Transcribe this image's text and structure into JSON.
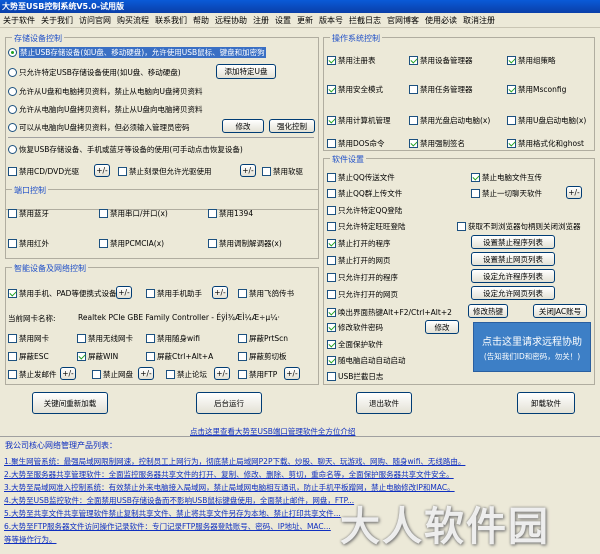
{
  "window": {
    "title": "大势至USB控制系统V5.0-试用版"
  },
  "menu": [
    "关于软件",
    "关于我们",
    "访问官网",
    "购买流程",
    "联系我们",
    "帮助",
    "远程协助",
    "注册",
    "设置",
    "更新",
    "版本号",
    "拦截日志",
    "官网博客",
    "使用必读",
    "取消注册"
  ],
  "storage": {
    "title": "存储设备控制",
    "opt1": "禁止USB存储设备(如U盘、移动硬盘)，允许使用USB鼠标、键盘和加密狗",
    "opt2": "只允许特定USB存储设备使用(如U盘、移动硬盘)",
    "add_usb_button": "添加特定U盘",
    "opt3": "允许从U盘和电脑拷贝资料，禁止从电脑向U盘拷贝资料",
    "opt4": "允许从电脑向U盘拷贝资料，禁止从U盘向电脑拷贝资料",
    "opt5": "可以从电脑向U盘拷贝资料，但必须输入管理员密码",
    "modify_button": "修改",
    "force_button": "强化控制",
    "opt6": "恢复USB存储设备、手机或蓝牙等设备的使用(可手动点击恢复设备)",
    "cd_label": "禁用CD/DVD光驱",
    "cd_plus": "+/-",
    "burn_label": "禁止刻录但允许光驱使用",
    "burn_plus": "+/-",
    "floppy_label": "禁用软驱"
  },
  "port": {
    "title": "端口控制",
    "bluetooth": "禁用蓝牙",
    "serial": "禁用串口/并口(x)",
    "ieee": "禁用1394",
    "infrared": "禁用红外",
    "pcmcia": "禁用PCMCIA(x)",
    "modem": "禁用调制解调器(x)"
  },
  "smart": {
    "title": "智能设备及网络控制",
    "phone": "禁用手机、PAD等便携式设备",
    "phone_plus": "+/-",
    "phone_helper": "禁用手机助手",
    "helper_plus": "+/-",
    "wifi_stick": "禁用随身wifi",
    "nic_label": "当前网卡名称:",
    "nic_value": "Realtek PCIe GBE Family Controller - ÉÿÌ¾ÆÌ¼Æ÷µ¼·",
    "net_control": "禁用网卡",
    "wireless_nic": "禁用无线网卡",
    "wifi_flying": "禁用飞鸽传书",
    "print_scn": "屏蔽PrtScn",
    "screen_esc": "屏蔽ESC",
    "screen_win": "屏蔽WIN",
    "ctrl_alt": "屏蔽Ctrl+Alt+A",
    "clipboard": "屏蔽剪切板",
    "send_mail": "禁止发邮件",
    "send_plus": "+/-",
    "net_disk": "禁止网盘",
    "disk_plus": "+/-",
    "forum": "禁止论坛",
    "forum_plus": "+/-",
    "ftp": "禁用FTP",
    "ftp_plus": "+/-"
  },
  "os": {
    "title": "操作系统控制",
    "items": [
      "禁用注册表",
      "禁用设备管理器",
      "禁用组策略",
      "禁用安全模式",
      "禁用任务管理器",
      "禁用Msconfig",
      "禁用计算机管理",
      "禁用光盘启动电脑(x)",
      "禁用U盘启动电脑(x)",
      "禁用DOS命令",
      "禁用强制签名",
      "禁用格式化和ghost"
    ]
  },
  "software": {
    "title": "软件设置",
    "qq_transfer": "禁止QQ传送文件",
    "upload_qq": "禁止电脑文件互传",
    "qq_upload": "禁止QQ群上传文件",
    "stop_all": "禁止一切聊天软件",
    "stop_plus": "+/-",
    "allow_qq": "只允许特定QQ登陆",
    "allow_ww": "只允许特定旺旺登陆",
    "browser": "获取不到浏览器句柄则关闭浏览器",
    "block_prog": "禁止打开的程序",
    "block_prog_btn": "设置禁止程序列表",
    "block_web": "禁止打开的网页",
    "block_web_btn": "设置禁止网页列表",
    "allow_prog": "只允许打开的程序",
    "allow_prog_btn": "设定允许程序列表",
    "allow_web": "只允许打开的网页",
    "allow_web_btn": "设定允许网页列表",
    "hotkey": "唤出界面热键Alt+F2/Ctrl+Alt+2",
    "modify_hotkey_btn": "修改热键",
    "close_jac_btn": "关闭JAC账号",
    "password": "修改软件密码",
    "password_btn": "修改",
    "protect": "全面保护软件",
    "autostart": "随电脑启动自动启动",
    "usb_log": "USB拦截日志"
  },
  "promo": {
    "line1": "点击这里请求远程协助",
    "line2": "(告知我们ID和密码，勿关！)"
  },
  "actions": {
    "close_hide": "关键间重新加载",
    "background": "后台运行",
    "exit": "退出软件",
    "uninstall": "卸载软件"
  },
  "products_link": "点击这里查看大势至USB端口管理软件全方位介绍",
  "intro": {
    "title": "我公司核心网络管理产品列表：",
    "lines": [
      "1.聚生网管系统：最强局域网限制网速，控制员工上网行为，彻底禁止局域网P2P下载、炒股、聊天、玩游戏、网购、随身wifi、无线路由。",
      "2.大势至服务器共享管理软件：全面监控服务器共享文件的打开、复制、修改、删除、剪切，重命名等，全面保护服务器共享文件安全。",
      "3.大势至局域网准入控制系统：有效禁止外来电脑接入局域网，禁止局域网电脑相互通讯，防止手机平板蹭网，禁止电脑修改IP和MAC。",
      "4.大势至USB监控软件：全面禁用USB存储设备而不影响USB鼠标键盘使用，全面禁止邮件，网盘，FTP...",
      "5.大势至共享文件共享管理软件禁止复制共享文件、禁止将共享文件另存为本地、禁止打印共享文件...",
      "6.大势至FTP服务器文件访问操作记录软件：专门记录FTP服务器登陆账号、密码、IP地址、MAC...",
      "等等操作行为。"
    ]
  },
  "watermark": "大人软件园"
}
